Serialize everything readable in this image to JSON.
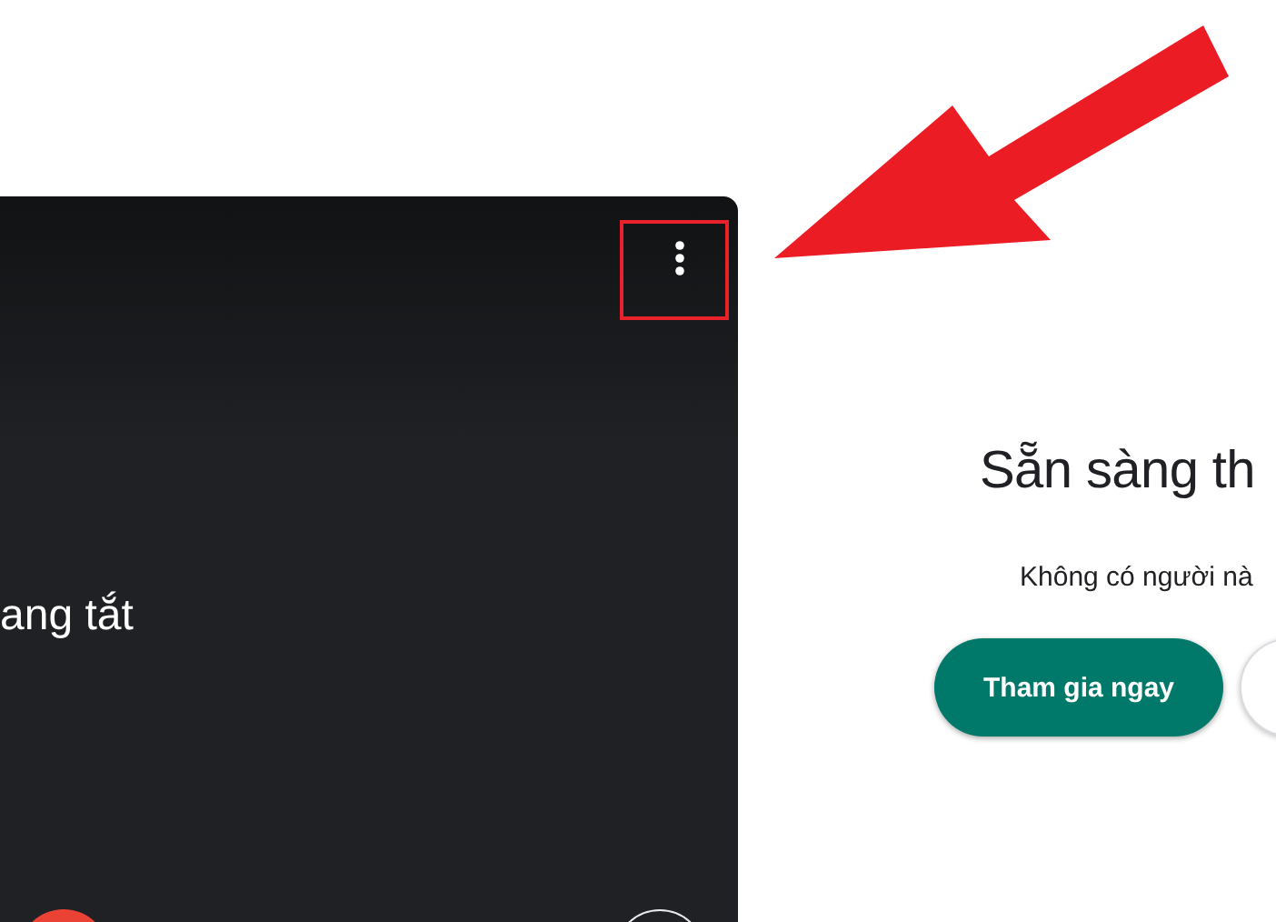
{
  "preview": {
    "status_text": "ang tắt",
    "more_button": {
      "highlighted": true
    }
  },
  "join": {
    "title": "Sẵn sàng th",
    "subtitle": "Không có người nà",
    "buttons": [
      {
        "label": "Tham gia ngay",
        "kind": "primary"
      },
      {
        "kind": "secondary"
      }
    ]
  }
}
